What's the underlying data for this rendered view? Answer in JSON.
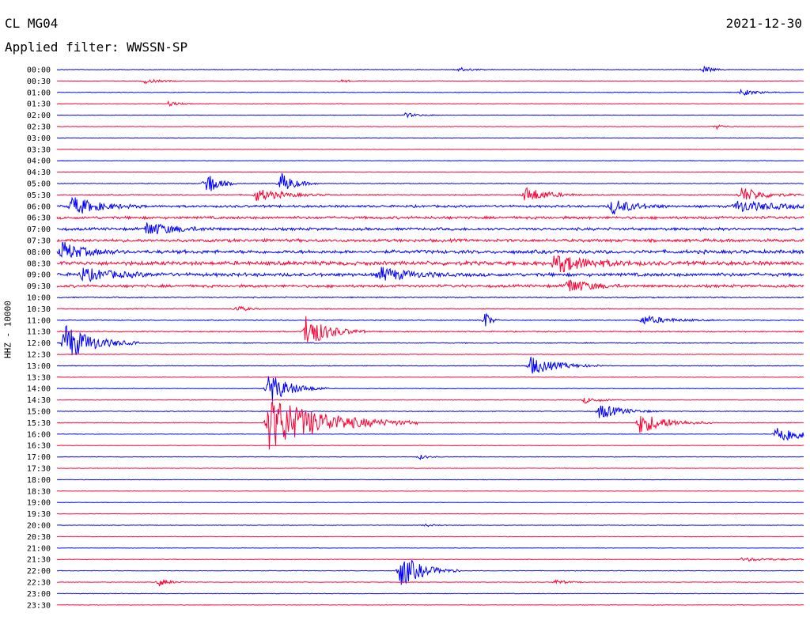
{
  "header": {
    "station": "CL MG04",
    "filter": "Applied filter: WWSSN-SP",
    "date": "2021-12-30"
  },
  "colors": {
    "even_trace": "#0000ff",
    "odd_trace": "#ff0033",
    "background": "#ffffff",
    "text": "#000000"
  },
  "chart_data": {
    "type": "helicorder",
    "title": "",
    "ylabel": "HHZ - 10000",
    "xlabel": "",
    "grid": false,
    "legend": "none",
    "trace_minutes": 30,
    "row_labels": [
      "00:00",
      "00:30",
      "01:00",
      "01:30",
      "02:00",
      "02:30",
      "03:00",
      "03:30",
      "04:00",
      "04:30",
      "05:00",
      "05:30",
      "06:00",
      "06:30",
      "07:00",
      "07:30",
      "08:00",
      "08:30",
      "09:00",
      "09:30",
      "10:00",
      "10:30",
      "11:00",
      "11:30",
      "12:00",
      "12:30",
      "13:00",
      "13:30",
      "14:00",
      "14:30",
      "15:00",
      "15:30",
      "16:00",
      "16:30",
      "17:00",
      "17:30",
      "18:00",
      "18:30",
      "19:00",
      "19:30",
      "20:00",
      "20:30",
      "21:00",
      "21:30",
      "22:00",
      "22:30",
      "23:00",
      "23:30"
    ],
    "row_noise": [
      0.3,
      0.3,
      0.35,
      0.3,
      0.25,
      0.25,
      0.3,
      0.25,
      0.3,
      0.3,
      0.4,
      0.6,
      1.2,
      1.4,
      1.4,
      1.5,
      1.8,
      2.0,
      1.8,
      1.4,
      0.6,
      0.5,
      0.5,
      0.6,
      0.5,
      0.3,
      0.4,
      0.3,
      0.3,
      0.35,
      0.4,
      0.4,
      0.3,
      0.25,
      0.3,
      0.25,
      0.25,
      0.25,
      0.25,
      0.25,
      0.25,
      0.25,
      0.25,
      0.3,
      0.3,
      0.3,
      0.3,
      0.3
    ],
    "events": [
      {
        "row": 0,
        "minute": 16.1,
        "amp": 3,
        "dur": 0.5
      },
      {
        "row": 0,
        "minute": 26.0,
        "amp": 5,
        "dur": 0.3
      },
      {
        "row": 1,
        "minute": 3.5,
        "amp": 3,
        "dur": 0.6
      },
      {
        "row": 1,
        "minute": 11.4,
        "amp": 2,
        "dur": 0.4
      },
      {
        "row": 2,
        "minute": 27.5,
        "amp": 4,
        "dur": 0.6
      },
      {
        "row": 3,
        "minute": 4.5,
        "amp": 4,
        "dur": 0.3
      },
      {
        "row": 4,
        "minute": 14.0,
        "amp": 3,
        "dur": 0.5
      },
      {
        "row": 5,
        "minute": 26.5,
        "amp": 3,
        "dur": 0.3
      },
      {
        "row": 10,
        "minute": 6.0,
        "amp": 18,
        "dur": 0.4
      },
      {
        "row": 10,
        "minute": 9.0,
        "amp": 14,
        "dur": 0.5
      },
      {
        "row": 11,
        "minute": 8.0,
        "amp": 8,
        "dur": 1.0
      },
      {
        "row": 11,
        "minute": 18.8,
        "amp": 10,
        "dur": 0.8
      },
      {
        "row": 11,
        "minute": 27.5,
        "amp": 10,
        "dur": 0.8
      },
      {
        "row": 12,
        "minute": 0.6,
        "amp": 12,
        "dur": 1.0
      },
      {
        "row": 12,
        "minute": 22.3,
        "amp": 10,
        "dur": 0.8
      },
      {
        "row": 12,
        "minute": 27.3,
        "amp": 7,
        "dur": 1.5
      },
      {
        "row": 14,
        "minute": 3.6,
        "amp": 9,
        "dur": 1.0
      },
      {
        "row": 16,
        "minute": 0.2,
        "amp": 12,
        "dur": 0.8
      },
      {
        "row": 17,
        "minute": 20.0,
        "amp": 12,
        "dur": 1.2
      },
      {
        "row": 18,
        "minute": 1.0,
        "amp": 8,
        "dur": 1.2
      },
      {
        "row": 18,
        "minute": 13.0,
        "amp": 9,
        "dur": 1.0
      },
      {
        "row": 19,
        "minute": 20.5,
        "amp": 10,
        "dur": 0.8
      },
      {
        "row": 21,
        "minute": 7.2,
        "amp": 4,
        "dur": 0.4
      },
      {
        "row": 22,
        "minute": 17.2,
        "amp": 12,
        "dur": 0.2
      },
      {
        "row": 22,
        "minute": 23.5,
        "amp": 6,
        "dur": 1.0
      },
      {
        "row": 23,
        "minute": 10.0,
        "amp": 22,
        "dur": 0.8
      },
      {
        "row": 24,
        "minute": 0.3,
        "amp": 25,
        "dur": 1.0
      },
      {
        "row": 26,
        "minute": 19.0,
        "amp": 12,
        "dur": 1.0
      },
      {
        "row": 28,
        "minute": 8.5,
        "amp": 20,
        "dur": 0.8
      },
      {
        "row": 29,
        "minute": 21.2,
        "amp": 4,
        "dur": 0.6
      },
      {
        "row": 30,
        "minute": 21.8,
        "amp": 10,
        "dur": 0.8
      },
      {
        "row": 31,
        "minute": 8.5,
        "amp": 35,
        "dur": 2.0
      },
      {
        "row": 31,
        "minute": 23.4,
        "amp": 14,
        "dur": 1.0
      },
      {
        "row": 32,
        "minute": 28.9,
        "amp": 12,
        "dur": 1.2
      },
      {
        "row": 34,
        "minute": 14.6,
        "amp": 3,
        "dur": 0.3
      },
      {
        "row": 40,
        "minute": 14.8,
        "amp": 2,
        "dur": 0.3
      },
      {
        "row": 43,
        "minute": 27.5,
        "amp": 2,
        "dur": 1.6
      },
      {
        "row": 44,
        "minute": 13.8,
        "amp": 22,
        "dur": 0.8
      },
      {
        "row": 45,
        "minute": 4.1,
        "amp": 5,
        "dur": 0.4
      },
      {
        "row": 45,
        "minute": 20.0,
        "amp": 3,
        "dur": 0.5
      }
    ]
  }
}
